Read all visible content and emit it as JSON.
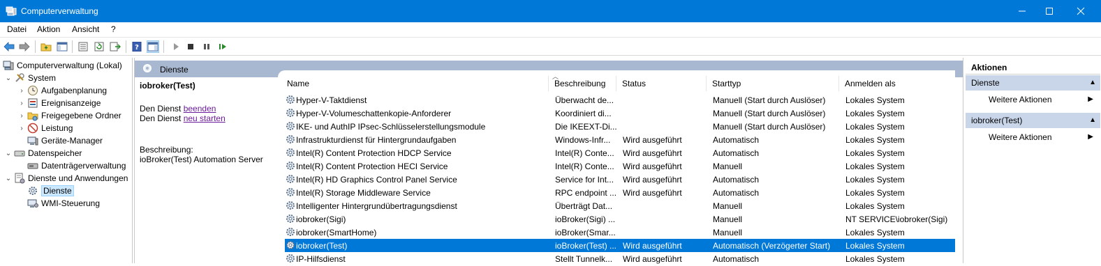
{
  "window": {
    "title": "Computerverwaltung",
    "controls": {
      "minimize": "minimize-icon",
      "maximize": "maximize-icon",
      "close": "close-icon"
    }
  },
  "menu": [
    "Datei",
    "Aktion",
    "Ansicht",
    "?"
  ],
  "toolbar": {
    "icons": [
      "back-arrow-icon",
      "forward-arrow-icon",
      "up-folder-icon",
      "show-hide-tree-icon",
      "properties-icon",
      "refresh-icon",
      "export-list-icon",
      "help-icon",
      "show-hide-action-pane-icon",
      "start-service-icon",
      "stop-service-icon",
      "pause-service-icon",
      "resume-service-icon"
    ]
  },
  "tree": {
    "root": "Computerverwaltung (Lokal)",
    "nodes": [
      {
        "label": "System",
        "level": 1,
        "expanded": true
      },
      {
        "label": "Aufgabenplanung",
        "level": 2
      },
      {
        "label": "Ereignisanzeige",
        "level": 2
      },
      {
        "label": "Freigegebene Ordner",
        "level": 2
      },
      {
        "label": "Leistung",
        "level": 2
      },
      {
        "label": "Geräte-Manager",
        "level": 2
      },
      {
        "label": "Datenspeicher",
        "level": 1,
        "expanded": true
      },
      {
        "label": "Datenträgerverwaltung",
        "level": 2
      },
      {
        "label": "Dienste und Anwendungen",
        "level": 1,
        "expanded": true
      },
      {
        "label": "Dienste",
        "level": 2,
        "selected": true
      },
      {
        "label": "WMI-Steuerung",
        "level": 2
      }
    ]
  },
  "services_header": "Dienste",
  "detail": {
    "name": "iobroker(Test)",
    "stop_prefix": "Den Dienst ",
    "stop_link": "beenden",
    "restart_prefix": "Den Dienst ",
    "restart_link": "neu starten",
    "description_label": "Beschreibung:",
    "description": "ioBroker(Test) Automation Server"
  },
  "columns": [
    "Name",
    "Beschreibung",
    "Status",
    "Starttyp",
    "Anmelden als"
  ],
  "rows": [
    {
      "name": "Hyper-V-Taktdienst",
      "desc": "Überwacht de...",
      "status": "",
      "start": "Manuell (Start durch Auslöser)",
      "logon": "Lokales System"
    },
    {
      "name": "Hyper-V-Volumeschattenkopie-Anforderer",
      "desc": "Koordiniert di...",
      "status": "",
      "start": "Manuell (Start durch Auslöser)",
      "logon": "Lokales System"
    },
    {
      "name": "IKE- und AuthIP IPsec-Schlüsselerstellungsmodule",
      "desc": "Die IKEEXT-Di...",
      "status": "",
      "start": "Manuell (Start durch Auslöser)",
      "logon": "Lokales System"
    },
    {
      "name": "Infrastrukturdienst für Hintergrundaufgaben",
      "desc": "Windows-Infr...",
      "status": "Wird ausgeführt",
      "start": "Automatisch",
      "logon": "Lokales System"
    },
    {
      "name": "Intel(R) Content Protection HDCP Service",
      "desc": "Intel(R) Conte...",
      "status": "Wird ausgeführt",
      "start": "Automatisch",
      "logon": "Lokales System"
    },
    {
      "name": "Intel(R) Content Protection HECI Service",
      "desc": "Intel(R) Conte...",
      "status": "Wird ausgeführt",
      "start": "Manuell",
      "logon": "Lokales System"
    },
    {
      "name": "Intel(R) HD Graphics Control Panel Service",
      "desc": "Service for Int...",
      "status": "Wird ausgeführt",
      "start": "Automatisch",
      "logon": "Lokales System"
    },
    {
      "name": "Intel(R) Storage Middleware Service",
      "desc": "RPC endpoint ...",
      "status": "Wird ausgeführt",
      "start": "Automatisch",
      "logon": "Lokales System"
    },
    {
      "name": "Intelligenter Hintergrundübertragungsdienst",
      "desc": "Überträgt Dat...",
      "status": "",
      "start": "Manuell",
      "logon": "Lokales System"
    },
    {
      "name": "iobroker(Sigi)",
      "desc": "ioBroker(Sigi) ...",
      "status": "",
      "start": "Manuell",
      "logon": "NT SERVICE\\iobroker(Sigi)"
    },
    {
      "name": "iobroker(SmartHome)",
      "desc": "ioBroker(Smar...",
      "status": "",
      "start": "Manuell",
      "logon": "Lokales System"
    },
    {
      "name": "iobroker(Test)",
      "desc": "ioBroker(Test) ...",
      "status": "Wird ausgeführt",
      "start": "Automatisch (Verzögerter Start)",
      "logon": "Lokales System",
      "selected": true
    },
    {
      "name": "IP-Hilfsdienst",
      "desc": "Stellt Tunnelk...",
      "status": "Wird ausgeführt",
      "start": "Automatisch",
      "logon": "Lokales System"
    }
  ],
  "actions": {
    "header": "Aktionen",
    "sections": [
      {
        "title": "Dienste",
        "item": "Weitere Aktionen"
      },
      {
        "title": "iobroker(Test)",
        "item": "Weitere Aktionen"
      }
    ]
  },
  "colors": {
    "titlebar": "#0078d7",
    "selection": "#0078d7",
    "section_header": "#c9d6ea",
    "services_banner": "#a8b8d0"
  }
}
